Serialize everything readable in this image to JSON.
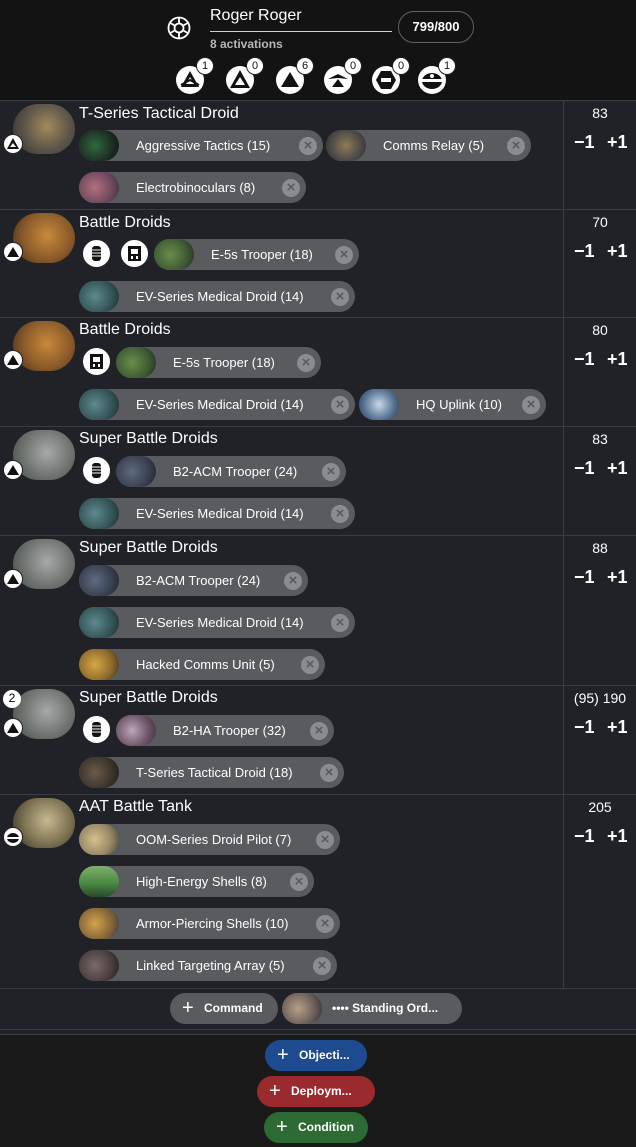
{
  "header": {
    "title": "Roger Roger",
    "activations": "8 activations",
    "points": "799/800",
    "faction_icon": "separatist-icon",
    "ranks": [
      {
        "name": "commander",
        "count": "1"
      },
      {
        "name": "operative",
        "count": "0"
      },
      {
        "name": "corps",
        "count": "6"
      },
      {
        "name": "special-forces",
        "count": "0"
      },
      {
        "name": "support",
        "count": "0"
      },
      {
        "name": "heavy",
        "count": "1"
      }
    ]
  },
  "units": [
    {
      "name": "T-Series Tactical Droid",
      "cost": "83",
      "minus": "−1",
      "plus": "+1",
      "rank": "commander",
      "upgrades": [
        {
          "label": "Aggressive Tactics (15)"
        },
        {
          "label": "Comms Relay (5)"
        },
        {
          "label": "Electrobinoculars (8)"
        }
      ]
    },
    {
      "name": "Battle Droids",
      "cost": "70",
      "minus": "−1",
      "plus": "+1",
      "rank": "corps",
      "upgrades": [
        {
          "label": "E-5s Trooper (18)"
        },
        {
          "label": "EV-Series Medical Droid (14)"
        }
      ]
    },
    {
      "name": "Battle Droids",
      "cost": "80",
      "minus": "−1",
      "plus": "+1",
      "rank": "corps",
      "upgrades": [
        {
          "label": "E-5s Trooper (18)"
        },
        {
          "label": "EV-Series Medical Droid (14)"
        },
        {
          "label": "HQ Uplink (10)"
        }
      ]
    },
    {
      "name": "Super Battle Droids",
      "cost": "83",
      "minus": "−1",
      "plus": "+1",
      "rank": "corps",
      "upgrades": [
        {
          "label": "B2-ACM Trooper (24)"
        },
        {
          "label": "EV-Series Medical Droid (14)"
        }
      ]
    },
    {
      "name": "Super Battle Droids",
      "cost": "88",
      "minus": "−1",
      "plus": "+1",
      "rank": "corps",
      "upgrades": [
        {
          "label": "B2-ACM Trooper (24)"
        },
        {
          "label": "EV-Series Medical Droid (14)"
        },
        {
          "label": "Hacked Comms Unit (5)"
        }
      ]
    },
    {
      "name": "Super Battle Droids",
      "cost": "(95) 190",
      "minus": "−1",
      "plus": "+1",
      "rank": "corps",
      "count": "2",
      "upgrades": [
        {
          "label": "B2-HA Trooper (32)"
        },
        {
          "label": "T-Series Tactical Droid (18)"
        }
      ]
    },
    {
      "name": "AAT Battle Tank",
      "cost": "205",
      "minus": "−1",
      "plus": "+1",
      "rank": "heavy",
      "upgrades": [
        {
          "label": "OOM-Series Droid Pilot (7)"
        },
        {
          "label": "High-Energy Shells (8)"
        },
        {
          "label": "Armor-Piercing Shells (10)"
        },
        {
          "label": "Linked Targeting Array (5)"
        }
      ]
    }
  ],
  "close_glyph": "×",
  "plus_glyph": "+",
  "command": {
    "label": "Command",
    "standing_orders": "•••• Standing Ord..."
  },
  "cards": [
    {
      "label": "Objecti...",
      "color": "#1e4a8f"
    },
    {
      "label": "Deploym...",
      "color": "#9a2a2d"
    },
    {
      "label": "Condition",
      "color": "#2e6a34"
    }
  ]
}
